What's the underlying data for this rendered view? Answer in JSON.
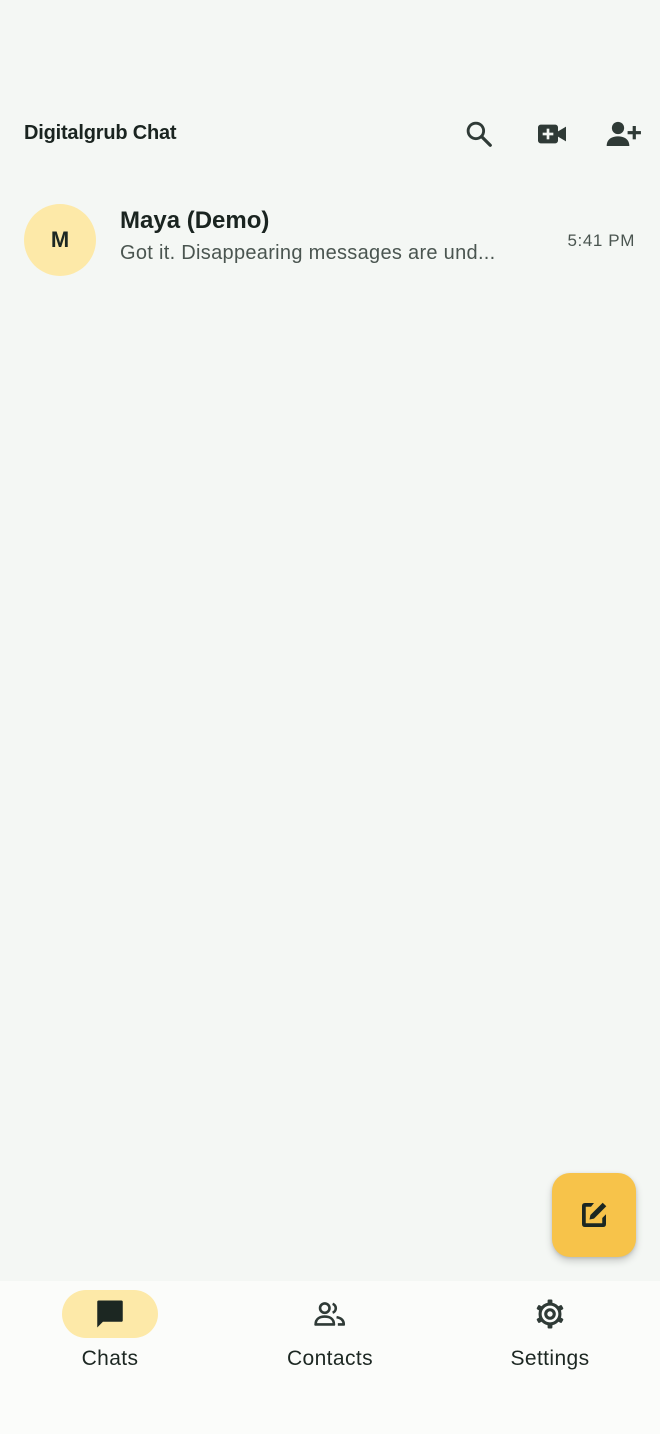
{
  "header": {
    "title": "Digitalgrub Chat",
    "icons": [
      "search-icon",
      "video-call-icon",
      "add-contact-icon"
    ]
  },
  "chats": [
    {
      "avatar_initial": "M",
      "name": "Maya (Demo)",
      "preview": "Got it. Disappearing messages are und...",
      "time": "5:41 PM"
    }
  ],
  "fab": {
    "icon": "compose-icon"
  },
  "bottom_nav": {
    "items": [
      {
        "label": "Chats",
        "icon": "chat-bubble-icon",
        "active": true
      },
      {
        "label": "Contacts",
        "icon": "people-icon",
        "active": false
      },
      {
        "label": "Settings",
        "icon": "gear-icon",
        "active": false
      }
    ]
  },
  "colors": {
    "background": "#f4f7f4",
    "accent": "#f7c34a",
    "accent_light": "#fde9a8",
    "icon": "#2f3a36"
  }
}
